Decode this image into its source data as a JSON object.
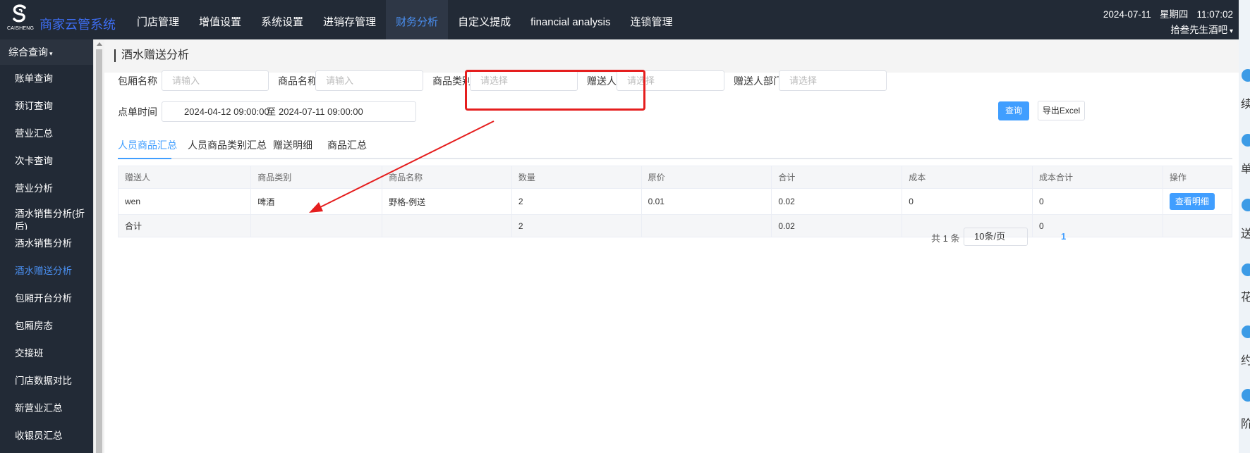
{
  "app": {
    "logo_caption": "CAISHENG",
    "brand": "商家云管系统"
  },
  "topnav": [
    {
      "label": "门店管理"
    },
    {
      "label": "增值设置"
    },
    {
      "label": "系统设置"
    },
    {
      "label": "进销存管理"
    },
    {
      "label": "财务分析",
      "active": true
    },
    {
      "label": "自定义提成"
    },
    {
      "label": "financial analysis"
    },
    {
      "label": "连锁管理"
    }
  ],
  "header_right": {
    "date": "2024-07-11",
    "weekday": "星期四",
    "time": "11:07:02",
    "user": "拾叁先生酒吧"
  },
  "sidebar": {
    "group_title": "综合查询",
    "items": [
      {
        "label": "账单查询"
      },
      {
        "label": "预订查询"
      },
      {
        "label": "营业汇总"
      },
      {
        "label": "次卡查询"
      },
      {
        "label": "营业分析"
      },
      {
        "label": "酒水销售分析(折后)"
      },
      {
        "label": "酒水销售分析"
      },
      {
        "label": "酒水赠送分析",
        "active": true
      },
      {
        "label": "包厢开台分析"
      },
      {
        "label": "包厢房态"
      },
      {
        "label": "交接班"
      },
      {
        "label": "门店数据对比"
      },
      {
        "label": "新营业汇总"
      },
      {
        "label": "收银员汇总"
      }
    ]
  },
  "page": {
    "title": "酒水赠送分析"
  },
  "filters": {
    "room_name": {
      "label": "包厢名称",
      "placeholder": "请输入"
    },
    "product_name": {
      "label": "商品名称",
      "placeholder": "请输入"
    },
    "product_category": {
      "label": "商品类别",
      "placeholder": "请选择"
    },
    "giver": {
      "label": "赠送人",
      "placeholder": "请选择"
    },
    "giver_dept": {
      "label": "赠送人部门",
      "placeholder": "请选择"
    },
    "order_time": {
      "label": "点单时间",
      "start": "2024-04-12 09:00:00",
      "separator": "至",
      "end": "2024-07-11 09:00:00"
    }
  },
  "actions": {
    "query_label": "查询",
    "export_label": "导出Excel"
  },
  "tabs": [
    {
      "label": "人员商品汇总",
      "active": true
    },
    {
      "label": "人员商品类别汇总"
    },
    {
      "label": "赠送明细"
    },
    {
      "label": "商品汇总"
    }
  ],
  "table": {
    "columns": [
      "赠送人",
      "商品类别",
      "商品名称",
      "数量",
      "原价",
      "合计",
      "成本",
      "成本合计",
      "操作"
    ],
    "rows": [
      {
        "giver": "wen",
        "category": "啤酒",
        "product": "野格-例送",
        "qty": "2",
        "price": "0.01",
        "total": "0.02",
        "cost": "0",
        "cost_total": "0",
        "action_label": "查看明细"
      }
    ],
    "summary": {
      "label": "合计",
      "qty": "2",
      "total": "0.02",
      "cost_total": "0"
    }
  },
  "pagination": {
    "total_text": "共 1 条",
    "page_size": "10条/页",
    "current_page": "1"
  },
  "colors": {
    "topbar_bg": "#222a36",
    "accent": "#409eff",
    "annotation_red": "#e51e1e"
  },
  "right_edge": {
    "chars": [
      "续",
      "单",
      "送",
      "花",
      "约",
      "阶"
    ]
  }
}
